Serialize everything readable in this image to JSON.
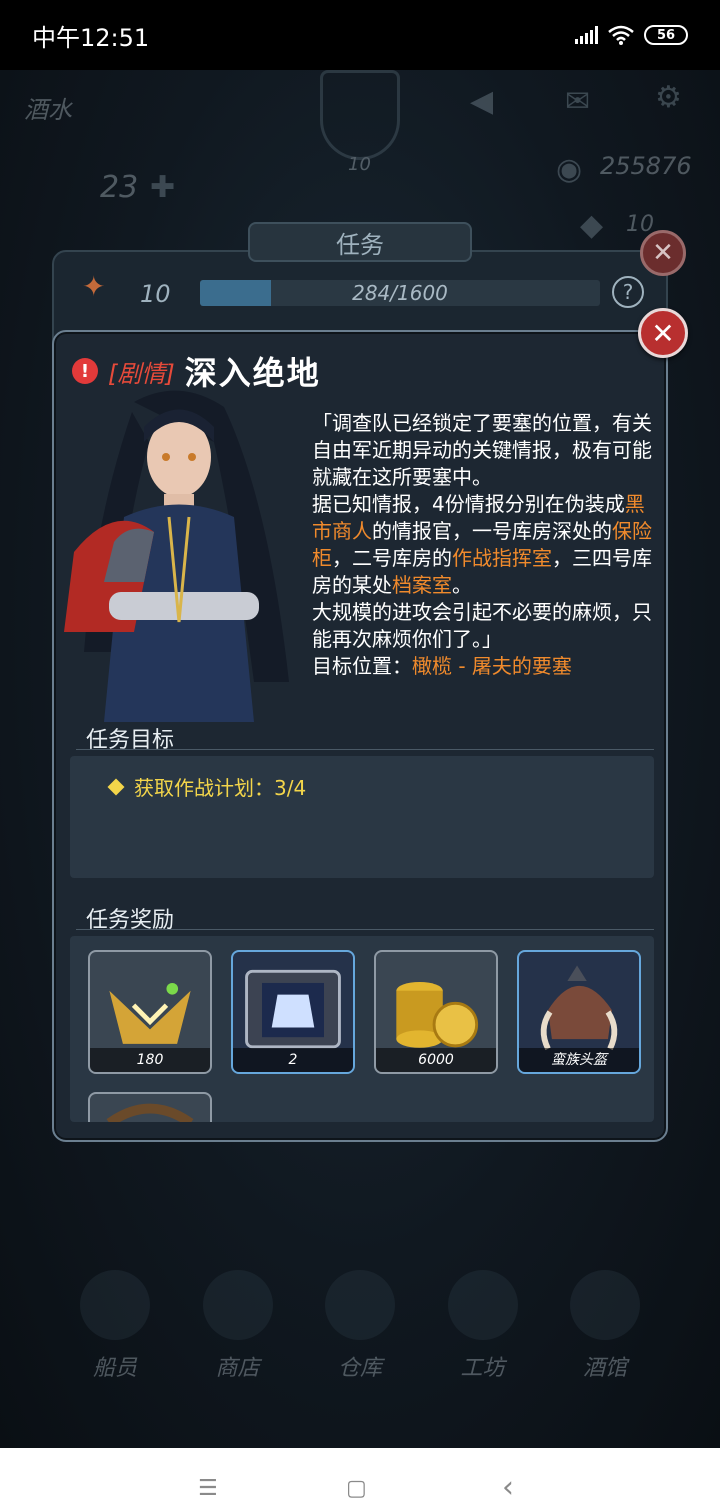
{
  "status_bar": {
    "time": "中午12:51",
    "battery": "56"
  },
  "background": {
    "player_name": "酒水",
    "level": "10",
    "energy": "23",
    "gold": "255876",
    "gems": "10",
    "quest_panel": {
      "title": "任务",
      "level": "10",
      "progress_text": "284/1600",
      "progress_value": 0.1775,
      "help_label": "?"
    },
    "nav": [
      {
        "label": "船员"
      },
      {
        "label": "商店"
      },
      {
        "label": "仓库"
      },
      {
        "label": "工坊"
      },
      {
        "label": "酒馆"
      }
    ]
  },
  "dialog": {
    "close_label": "✕",
    "tag": "[剧情]",
    "title": "深入绝地",
    "story": {
      "p1": "「调查队已经锁定了要塞的位置，有关自由军近期异动的关键情报，极有可能就藏在这所要塞中。",
      "p2_a": "据已知情报，4份情报分别在伪装成",
      "p2_hl1": "黑市商人",
      "p2_b": "的情报官，一号库房深处的",
      "p2_hl2": "保险柜",
      "p2_c": "，二号库房的",
      "p2_hl3": "作战指挥室",
      "p2_d": "，三四号库房的某处",
      "p2_hl4": "档案室",
      "p2_e": "。",
      "p3": "大规模的进攻会引起不必要的麻烦，只能再次麻烦你们了。」",
      "target_label": "目标位置：",
      "target_value": "橄榄 - 屠夫的要塞"
    },
    "objective_heading": "任务目标",
    "objective": "获取作战计划：3/4",
    "reward_heading": "任务奖励",
    "rewards": [
      {
        "qty": "180",
        "icon": "rank-emblem-icon"
      },
      {
        "qty": "2",
        "icon": "armor-crate-icon"
      },
      {
        "qty": "6000",
        "icon": "gold-coins-icon"
      },
      {
        "qty": "蛮族头盔",
        "icon": "barbarian-helmet-icon"
      }
    ]
  },
  "system_nav": {
    "menu": "☰",
    "home": "▢",
    "back": "‹"
  },
  "colors": {
    "highlight": "#f08a2c",
    "objective": "#f3d54a",
    "tag": "#e64a3a",
    "close": "#b82f2f"
  }
}
